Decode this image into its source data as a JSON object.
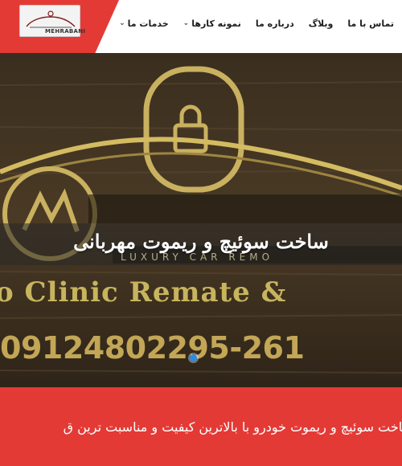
{
  "header": {
    "logo_text": "MEHRABANI",
    "nav": [
      {
        "label": "خدمات ما",
        "caret": true
      },
      {
        "label": "نمونه کارها",
        "caret": true
      },
      {
        "label": "درباره ما",
        "caret": false
      },
      {
        "label": "وبلاگ",
        "caret": false
      },
      {
        "label": "تماس با ما",
        "caret": false
      }
    ],
    "caret_glyph": "⌄"
  },
  "hero": {
    "title": "ساخت سوئیچ و ریموت مهربانی",
    "sign_brand": "LUXURY CAR REMO",
    "sign_line": "o Clinic Remate &",
    "sign_phone": "09124802295-261"
  },
  "strip": {
    "text": "ساخت سوئیچ و ریموت خودرو با بالاترین کیفیت و مناسبت ترین ق"
  },
  "colors": {
    "accent_red": "#e43a36",
    "carousel_dot": "#2f8ae0"
  }
}
